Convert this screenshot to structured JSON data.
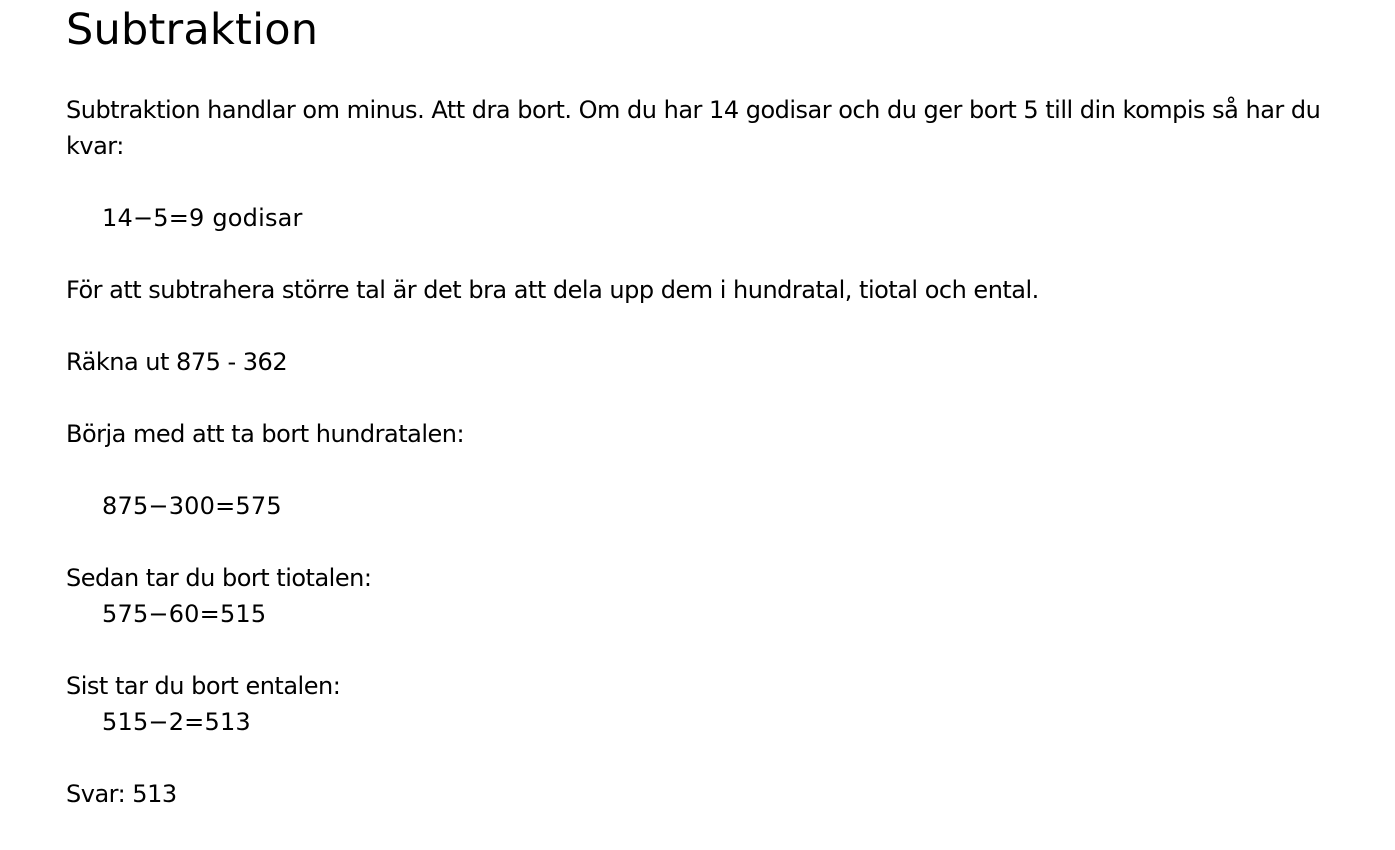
{
  "document": {
    "title": "Subtraktion",
    "intro": "Subtraktion handlar om minus. Att dra bort. Om du har 14 godisar och du ger bort 5 till din kompis så har du kvar:",
    "example_equation": "14−5=9 godisar",
    "larger_numbers_text": "För att subtrahera större tal är det bra att dela upp dem i hundratal, tiotal och ental.",
    "task": "Räkna ut 875 - 362",
    "step1_label": "Börja med att ta bort hundratalen:",
    "step1_equation": "875−300=575",
    "step2_label": "Sedan tar du bort tiotalen:",
    "step2_equation": "575−60=515",
    "step3_label": "Sist tar du bort entalen:",
    "step3_equation": "515−2=513",
    "answer": "Svar: 513"
  }
}
